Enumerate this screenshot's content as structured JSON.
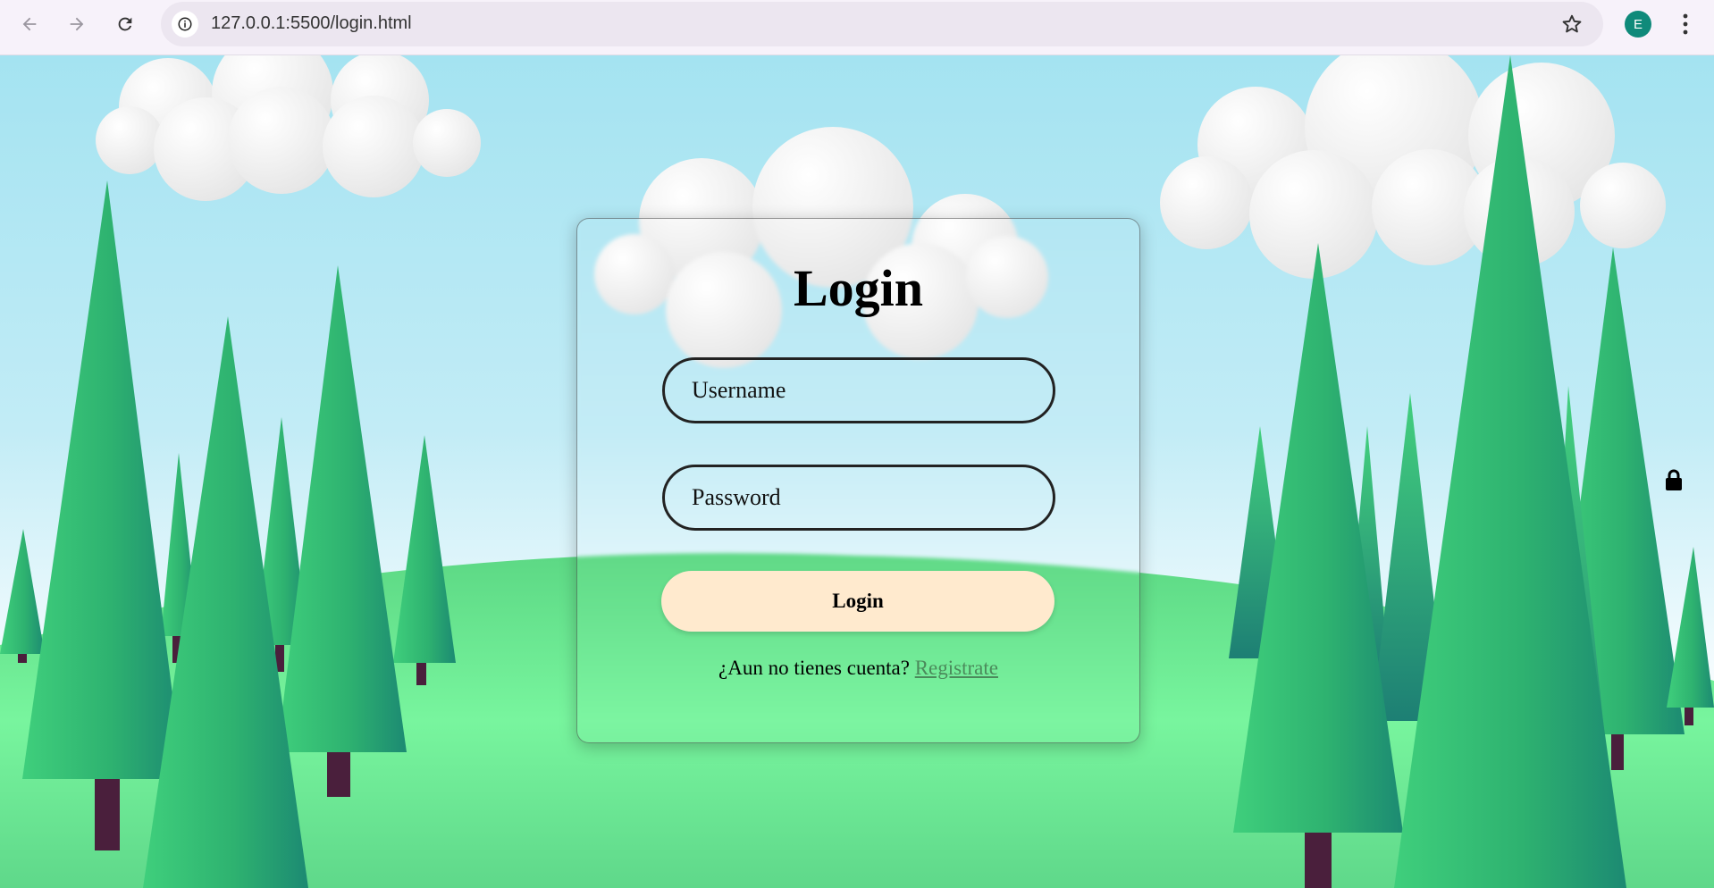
{
  "browser": {
    "url": "127.0.0.1:5500/login.html",
    "profile_initial": "E",
    "profile_color": "#0f8a7a",
    "icons": {
      "back": "arrow-left-icon",
      "forward": "arrow-right-icon",
      "reload": "reload-icon",
      "site_info": "info-icon",
      "bookmark": "star-icon",
      "menu": "more-vert-icon"
    }
  },
  "login_card": {
    "title": "Login",
    "username_placeholder": "Username",
    "password_placeholder": "Password",
    "submit_label": "Login",
    "signup_prompt": "¿Aun no tienes cuenta?",
    "signup_link": "Registrate"
  },
  "colors": {
    "sky_top": "#a4e3f1",
    "grass": "#6ee89a",
    "tree": "#2bb56f",
    "trunk": "#4a1f3c",
    "button_bg": "#ffeace",
    "link": "#4b8a5b"
  },
  "page_icons": [
    "lock-icon"
  ]
}
